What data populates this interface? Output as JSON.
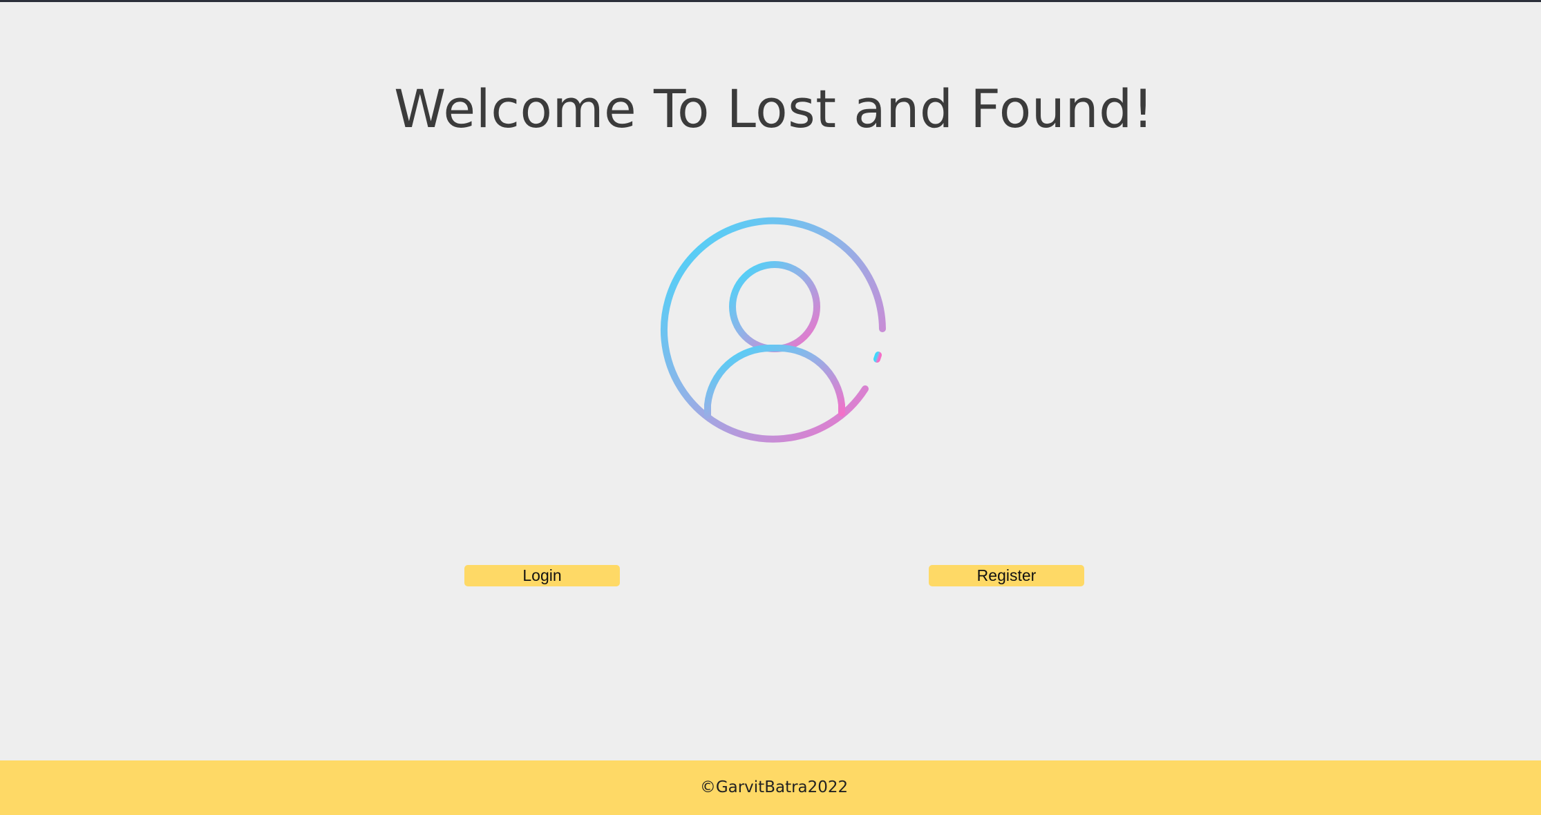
{
  "header": {
    "title": "Welcome To Lost and Found!"
  },
  "avatar": {
    "icon": "user-circle-icon",
    "gradient_start": "#40d8fb",
    "gradient_end": "#f56ec7"
  },
  "actions": {
    "login_label": "Login",
    "register_label": "Register",
    "button_color": "#fed966"
  },
  "footer": {
    "copyright": "©GarvitBatra2022",
    "background": "#fed966"
  }
}
